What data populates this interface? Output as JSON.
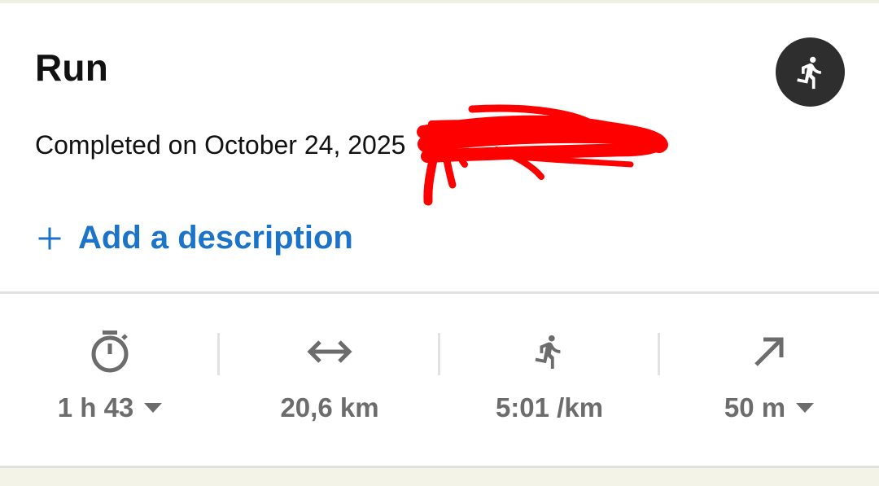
{
  "activity": {
    "title": "Run",
    "completed_text": "Completed on October 24, 2025",
    "type_icon": "running-person-icon"
  },
  "description": {
    "action_label": "Add a description",
    "icon": "plus-icon"
  },
  "stats": [
    {
      "id": "duration",
      "icon": "stopwatch-icon",
      "value": "1 h 43",
      "has_dropdown": true
    },
    {
      "id": "distance",
      "icon": "horizontal-arrows-icon",
      "value": "20,6 km",
      "has_dropdown": false
    },
    {
      "id": "pace",
      "icon": "running-person-icon",
      "value": "5:01 /km",
      "has_dropdown": false
    },
    {
      "id": "elevation",
      "icon": "up-right-arrow-icon",
      "value": "50 m",
      "has_dropdown": true
    }
  ],
  "colors": {
    "accent_blue": "#1b74c9",
    "stat_gray": "#6c6c6c",
    "badge_dark": "#2e2e2e",
    "redaction_red": "#ff0000"
  }
}
